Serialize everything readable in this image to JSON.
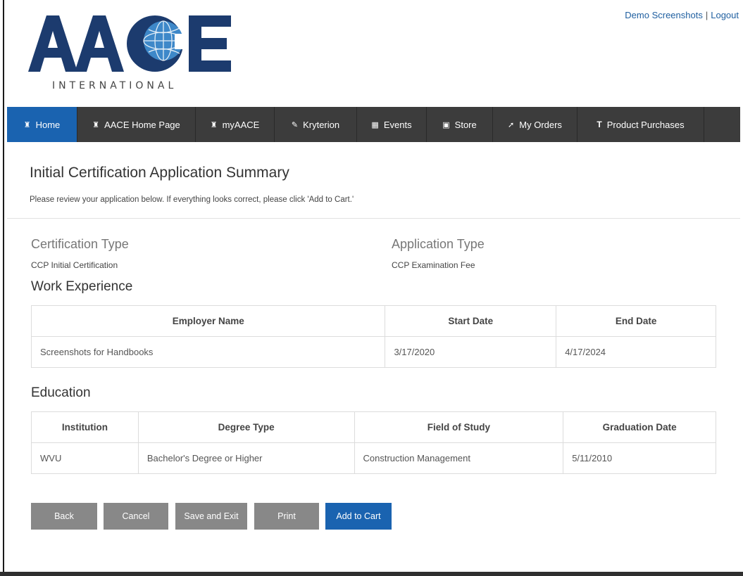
{
  "header": {
    "links": [
      {
        "label": "Demo Screenshots"
      },
      {
        "label": "Logout"
      }
    ],
    "separator": "|",
    "logo": {
      "wordmark": "AACE",
      "subtitle": "INTERNATIONAL"
    }
  },
  "nav": {
    "items": [
      {
        "label": "Home",
        "icon": "home-icon",
        "active": true
      },
      {
        "label": "AACE Home Page",
        "icon": "home-icon"
      },
      {
        "label": "myAACE",
        "icon": "home-icon"
      },
      {
        "label": "Kryterion",
        "icon": "edit-icon"
      },
      {
        "label": "Events",
        "icon": "calendar-icon"
      },
      {
        "label": "Store",
        "icon": "cart-icon"
      },
      {
        "label": "My Orders",
        "icon": "pushpin-icon"
      },
      {
        "label": "Product Purchases",
        "icon": "text-height-icon"
      }
    ]
  },
  "page": {
    "title": "Initial Certification Application Summary",
    "subtitle": "Please review your application below. If everything looks correct, please click 'Add to Cart.'"
  },
  "certification": {
    "label": "Certification Type",
    "value": "CCP Initial Certification"
  },
  "application": {
    "label": "Application Type",
    "value": "CCP Examination Fee"
  },
  "work_experience": {
    "heading": "Work Experience",
    "columns": [
      "Employer Name",
      "Start Date",
      "End Date"
    ],
    "rows": [
      [
        "Screenshots for Handbooks",
        "3/17/2020",
        "4/17/2024"
      ]
    ]
  },
  "education": {
    "heading": "Education",
    "columns": [
      "Institution",
      "Degree Type",
      "Field of Study",
      "Graduation Date"
    ],
    "rows": [
      [
        "WVU",
        "Bachelor's Degree or Higher",
        "Construction Management",
        "5/11/2010"
      ]
    ]
  },
  "buttons": {
    "back": "Back",
    "cancel": "Cancel",
    "save_exit": "Save and Exit",
    "print": "Print",
    "add_to_cart": "Add to Cart"
  },
  "colors": {
    "nav_bg": "#3c3c3c",
    "active_blue": "#1a63b0",
    "logo_navy": "#1c3b6e",
    "button_gray": "#888888"
  }
}
